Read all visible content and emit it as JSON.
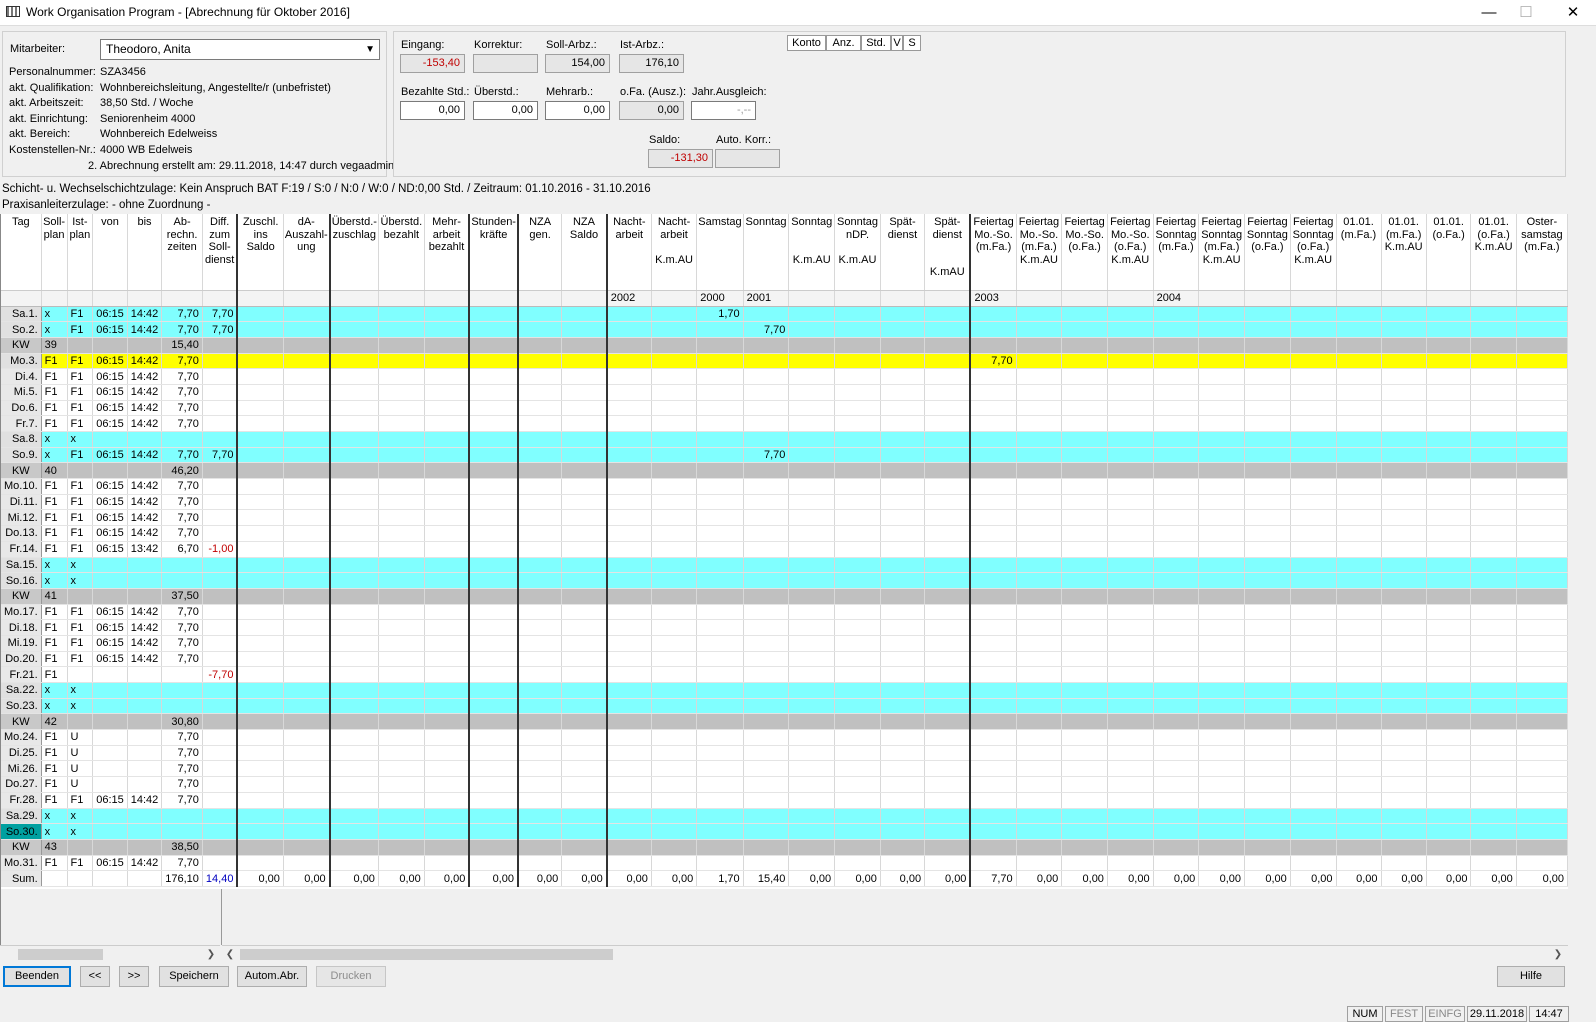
{
  "window": {
    "title": "Work Organisation Program - [Abrechnung für Oktober 2016]",
    "minimize": "—",
    "maximize": "☐",
    "close": "✕"
  },
  "employee": {
    "label_mitarbeiter": "Mitarbeiter:",
    "selected": "Theodoro, Anita",
    "rows": [
      {
        "label": "Personalnummer:",
        "value": "SZA3456"
      },
      {
        "label": "akt. Qualifikation:",
        "value": "Wohnbereichsleitung, Angestellte/r (unbefristet)"
      },
      {
        "label": "akt. Arbeitszeit:",
        "value": "38,50 Std. / Woche"
      },
      {
        "label": "akt. Einrichtung:",
        "value": "Seniorenheim 4000"
      },
      {
        "label": "akt. Bereich:",
        "value": "Wohnbereich Edelweiss"
      },
      {
        "label": "Kostenstellen-Nr.:",
        "value": "4000 WB Edelweis"
      }
    ],
    "created_note": "2. Abrechnung erstellt am: 29.11.2018, 14:47 durch vegaadmin"
  },
  "summary": {
    "eingang_label": "Eingang:",
    "eingang": "-153,40",
    "korrektur_label": "Korrektur:",
    "korrektur": "",
    "soll_label": "Soll-Arbz.:",
    "soll": "154,00",
    "ist_label": "Ist-Arbz.:",
    "ist": "176,10",
    "bezahlt_label": "Bezahlte Std.:",
    "bezahlt": "0,00",
    "ueberstd_label": "Überstd.:",
    "ueberstd": "0,00",
    "mehrarb_label": "Mehrarb.:",
    "mehrarb": "0,00",
    "ofa_label": "o.Fa. (Ausz.):",
    "ofa": "0,00",
    "jahr_label": "Jahr.Ausgleich:",
    "jahr": "-,--",
    "saldo_label": "Saldo:",
    "saldo": "-131,30",
    "autokorr_label": "Auto. Korr.:",
    "autokorr": ""
  },
  "konto_tabs": [
    "Konto",
    "Anz.",
    "Std.",
    "V",
    "S"
  ],
  "info_lines": {
    "schicht": "Schicht- u. Wechselschichtzulage: Kein Anspruch BAT   F:19 / S:0 / N:0 / W:0 / ND:0,00 Std. / Zeitraum: 01.10.2016 - 31.10.2016",
    "praxis": "Praxisanleiterzulage: - ohne Zuordnung -"
  },
  "grid": {
    "headers": [
      "Tag",
      "Soll-\nplan",
      "Ist-\nplan",
      "von",
      "bis",
      "Ab-\nrechn.\nzeiten",
      "Diff.\nzum\nSoll-\ndienst",
      "Zuschl.\nins\nSaldo",
      "dA-\nAuszahl-\nung",
      "Überstd.-\nzuschlag",
      "Überstd.\nbezahlt",
      "Mehr-\narbeit\nbezahlt",
      "Stunden-\nkräfte",
      "NZA\ngen.",
      "NZA\nSaldo",
      "Nacht-\narbeit",
      "Nacht-\narbeit\n\nK.m.AU",
      "Samstag",
      "Sonntag",
      "Sonntag\n\n\nK.m.AU",
      "Sonntag\nnDP.\n\nK.m.AU",
      "Spät-\ndienst",
      "Spät-\ndienst\n\n\nK.mAU",
      "Feiertag\nMo.-So.\n(m.Fa.)",
      "Feiertag\nMo.-So.\n(m.Fa.)\nK.m.AU",
      "Feiertag\nMo.-So.\n(o.Fa.)",
      "Feiertag\nMo.-So.\n(o.Fa.)\nK.m.AU",
      "Feiertag\nSonntag\n(m.Fa.)",
      "Feiertag\nSonntag\n(m.Fa.)\nK.m.AU",
      "Feiertag\nSonntag\n(o.Fa.)",
      "Feiertag\nSonntag\n(o.Fa.)\nK.m.AU",
      "01.01.\n(m.Fa.)",
      "01.01.\n(m.Fa.)\nK.m.AU",
      "01.01.\n(o.Fa.)",
      "01.01.\n(o.Fa.)\nK.m.AU",
      "Oster-\nsamstag\n(m.Fa.)"
    ],
    "codes": [
      "",
      "",
      "",
      "",
      "",
      "",
      "",
      "",
      "",
      "",
      "",
      "",
      "",
      "",
      "",
      "2002",
      "",
      "2000",
      "2001",
      "",
      "",
      "",
      "",
      "2003",
      "",
      "",
      "",
      "2004",
      "",
      "",
      "",
      "",
      "",
      "",
      "",
      ""
    ],
    "rows": [
      {
        "t": "cyan",
        "c": [
          "Sa.1.",
          "x",
          "F1",
          "06:15",
          "14:42",
          "7,70",
          "7,70",
          "",
          "",
          "",
          "",
          "",
          "",
          "",
          "",
          "",
          "",
          "1,70"
        ]
      },
      {
        "t": "cyan",
        "c": [
          "So.2.",
          "x",
          "F1",
          "06:15",
          "14:42",
          "7,70",
          "7,70",
          "",
          "",
          "",
          "",
          "",
          "",
          "",
          "",
          "",
          "",
          "",
          "7,70"
        ]
      },
      {
        "t": "kw",
        "c": [
          "KW",
          "39",
          "",
          "",
          "",
          "15,40"
        ]
      },
      {
        "t": "yellow",
        "c": [
          "Mo.3.",
          "F1",
          "F1",
          "06:15",
          "14:42",
          "7,70",
          "",
          "",
          "",
          "",
          "",
          "",
          "",
          "",
          "",
          "",
          "",
          "",
          "",
          "",
          "",
          "",
          "",
          "7,70"
        ]
      },
      {
        "t": "",
        "c": [
          "Di.4.",
          "F1",
          "F1",
          "06:15",
          "14:42",
          "7,70"
        ]
      },
      {
        "t": "",
        "c": [
          "Mi.5.",
          "F1",
          "F1",
          "06:15",
          "14:42",
          "7,70"
        ]
      },
      {
        "t": "",
        "c": [
          "Do.6.",
          "F1",
          "F1",
          "06:15",
          "14:42",
          "7,70"
        ]
      },
      {
        "t": "",
        "c": [
          "Fr.7.",
          "F1",
          "F1",
          "06:15",
          "14:42",
          "7,70"
        ]
      },
      {
        "t": "cyan",
        "c": [
          "Sa.8.",
          "x",
          "x"
        ]
      },
      {
        "t": "cyan",
        "c": [
          "So.9.",
          "x",
          "F1",
          "06:15",
          "14:42",
          "7,70",
          "7,70",
          "",
          "",
          "",
          "",
          "",
          "",
          "",
          "",
          "",
          "",
          "",
          "7,70"
        ]
      },
      {
        "t": "kw",
        "c": [
          "KW",
          "40",
          "",
          "",
          "",
          "46,20"
        ]
      },
      {
        "t": "",
        "c": [
          "Mo.10.",
          "F1",
          "F1",
          "06:15",
          "14:42",
          "7,70"
        ]
      },
      {
        "t": "",
        "c": [
          "Di.11.",
          "F1",
          "F1",
          "06:15",
          "14:42",
          "7,70"
        ]
      },
      {
        "t": "",
        "c": [
          "Mi.12.",
          "F1",
          "F1",
          "06:15",
          "14:42",
          "7,70"
        ]
      },
      {
        "t": "",
        "c": [
          "Do.13.",
          "F1",
          "F1",
          "06:15",
          "14:42",
          "7,70"
        ]
      },
      {
        "t": "",
        "c": [
          "Fr.14.",
          "F1",
          "F1",
          "06:15",
          "13:42",
          "6,70",
          "-1,00"
        ]
      },
      {
        "t": "cyan",
        "c": [
          "Sa.15.",
          "x",
          "x"
        ]
      },
      {
        "t": "cyan",
        "c": [
          "So.16.",
          "x",
          "x"
        ]
      },
      {
        "t": "kw",
        "c": [
          "KW",
          "41",
          "",
          "",
          "",
          "37,50"
        ]
      },
      {
        "t": "",
        "c": [
          "Mo.17.",
          "F1",
          "F1",
          "06:15",
          "14:42",
          "7,70"
        ]
      },
      {
        "t": "",
        "c": [
          "Di.18.",
          "F1",
          "F1",
          "06:15",
          "14:42",
          "7,70"
        ]
      },
      {
        "t": "",
        "c": [
          "Mi.19.",
          "F1",
          "F1",
          "06:15",
          "14:42",
          "7,70"
        ]
      },
      {
        "t": "",
        "c": [
          "Do.20.",
          "F1",
          "F1",
          "06:15",
          "14:42",
          "7,70"
        ]
      },
      {
        "t": "",
        "c": [
          "Fr.21.",
          "F1",
          "",
          "",
          "",
          "",
          "-7,70"
        ]
      },
      {
        "t": "cyan",
        "c": [
          "Sa.22.",
          "x",
          "x"
        ]
      },
      {
        "t": "cyan",
        "c": [
          "So.23.",
          "x",
          "x"
        ]
      },
      {
        "t": "kw",
        "c": [
          "KW",
          "42",
          "",
          "",
          "",
          "30,80"
        ]
      },
      {
        "t": "",
        "c": [
          "Mo.24.",
          "F1",
          "U",
          "",
          "",
          "7,70"
        ]
      },
      {
        "t": "",
        "c": [
          "Di.25.",
          "F1",
          "U",
          "",
          "",
          "7,70"
        ]
      },
      {
        "t": "",
        "c": [
          "Mi.26.",
          "F1",
          "U",
          "",
          "",
          "7,70"
        ]
      },
      {
        "t": "",
        "c": [
          "Do.27.",
          "F1",
          "U",
          "",
          "",
          "7,70"
        ]
      },
      {
        "t": "",
        "c": [
          "Fr.28.",
          "F1",
          "F1",
          "06:15",
          "14:42",
          "7,70"
        ]
      },
      {
        "t": "cyan",
        "c": [
          "Sa.29.",
          "x",
          "x"
        ]
      },
      {
        "t": "cyan",
        "sel": true,
        "c": [
          "So.30.",
          "x",
          "x"
        ]
      },
      {
        "t": "kw",
        "c": [
          "KW",
          "43",
          "",
          "",
          "",
          "38,50"
        ]
      },
      {
        "t": "",
        "c": [
          "Mo.31.",
          "F1",
          "F1",
          "06:15",
          "14:42",
          "7,70"
        ]
      },
      {
        "t": "sum",
        "c": [
          "Sum.",
          "",
          "",
          "",
          "",
          "176,10",
          "14,40",
          "0,00",
          "0,00",
          "0,00",
          "0,00",
          "0,00",
          "0,00",
          "0,00",
          "0,00",
          "0,00",
          "0,00",
          "1,70",
          "15,40",
          "0,00",
          "0,00",
          "0,00",
          "0,00",
          "7,70",
          "0,00",
          "0,00",
          "0,00",
          "0,00",
          "0,00",
          "0,00",
          "0,00",
          "0,00",
          "0,00",
          "0,00",
          "0,00",
          "0,00"
        ]
      }
    ]
  },
  "buttons": {
    "beenden": "Beenden",
    "prev": "<<",
    "next": ">>",
    "speichern": "Speichern",
    "autom": "Autom.Abr.",
    "drucken": "Drucken",
    "hilfe": "Hilfe"
  },
  "statusbar": {
    "num": "NUM",
    "fest": "FEST",
    "einfg": "EINFG",
    "date": "29.11.2018",
    "time": "14:47"
  }
}
